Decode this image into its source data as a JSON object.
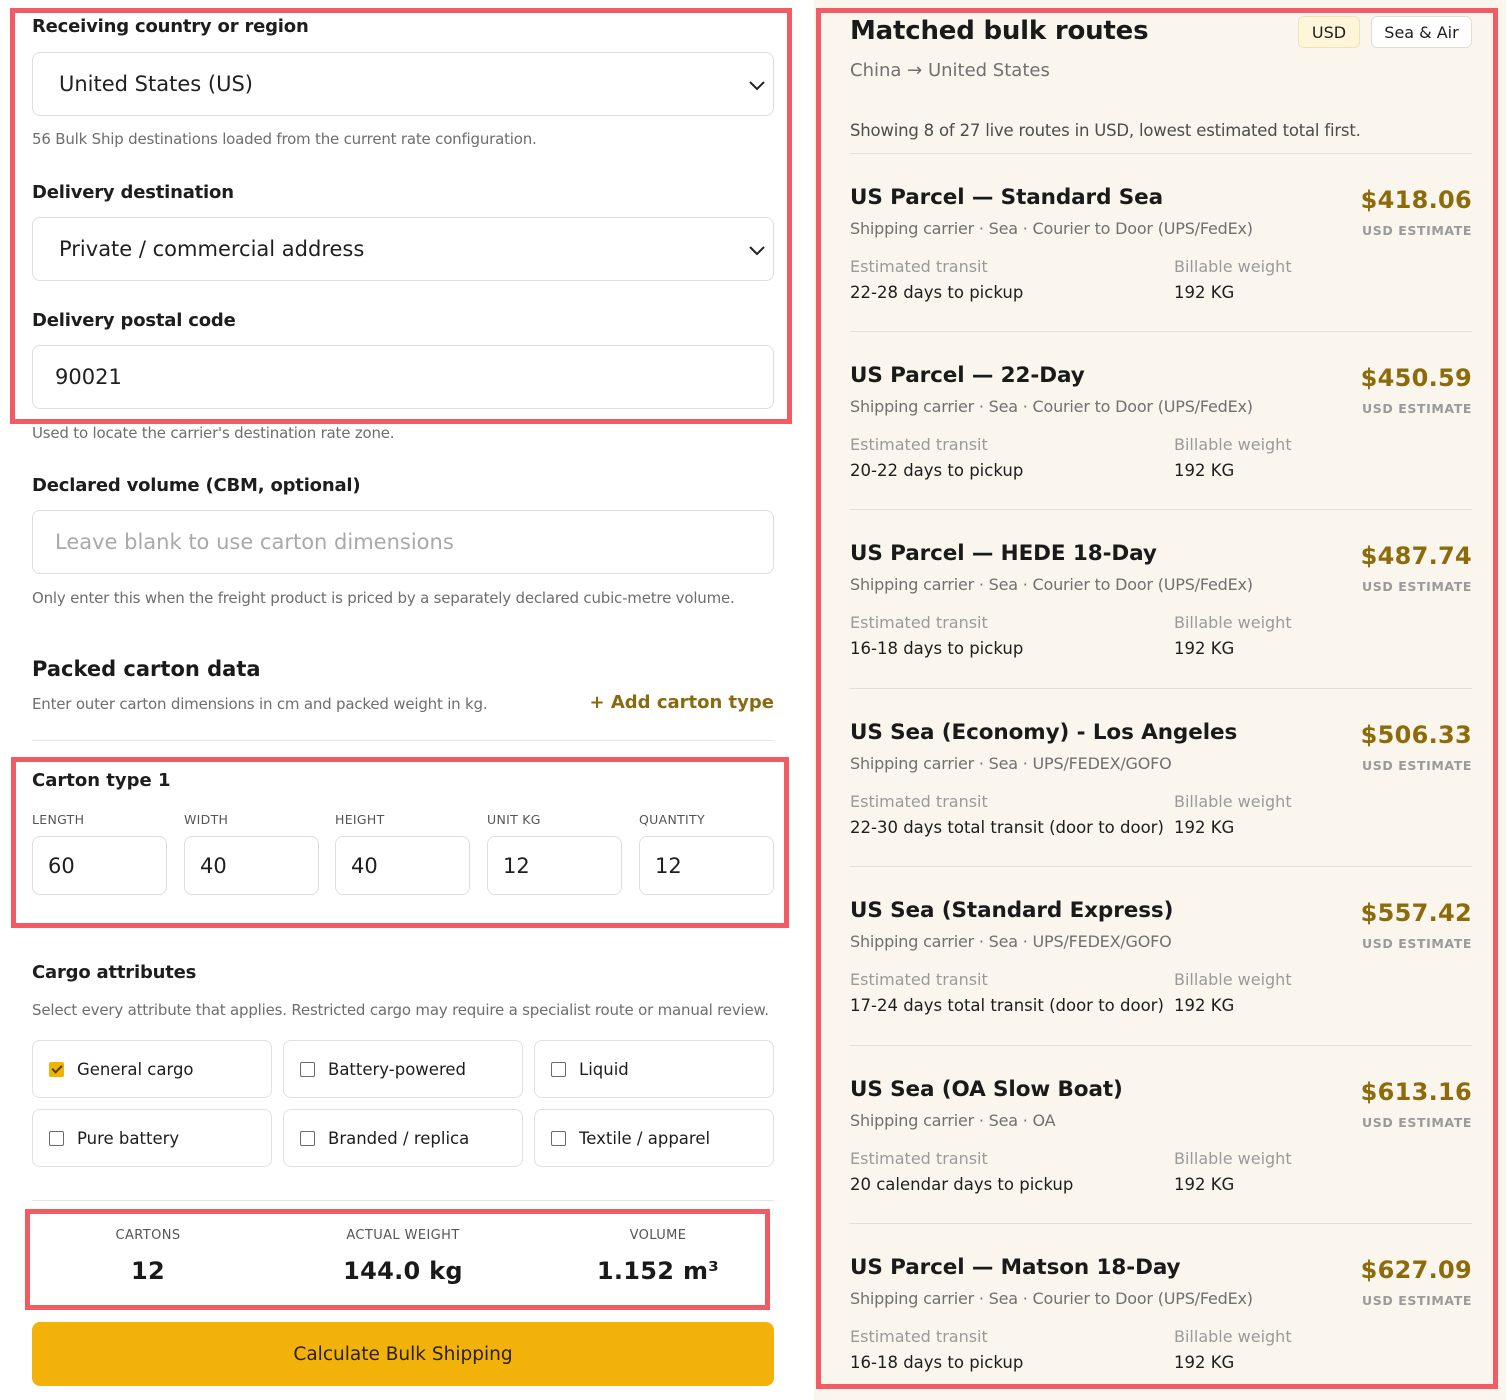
{
  "form": {
    "country_label": "Receiving country or region",
    "country_value": "United States (US)",
    "country_help": "56 Bulk Ship destinations loaded from the current rate configuration.",
    "destination_label": "Delivery destination",
    "destination_value": "Private / commercial address",
    "postal_label": "Delivery postal code",
    "postal_value": "90021",
    "postal_help": "Used to locate the carrier's destination rate zone.",
    "volume_label": "Declared volume (CBM, optional)",
    "volume_placeholder": "Leave blank to use carton dimensions",
    "volume_help": "Only enter this when the freight product is priced by a separately declared cubic-metre volume."
  },
  "carton_section": {
    "title": "Packed carton data",
    "help": "Enter outer carton dimensions in cm and packed weight in kg.",
    "add_label": "+ Add carton type",
    "carton_title": "Carton type 1",
    "fields": [
      {
        "label": "LENGTH",
        "value": "60"
      },
      {
        "label": "WIDTH",
        "value": "40"
      },
      {
        "label": "HEIGHT",
        "value": "40"
      },
      {
        "label": "UNIT KG",
        "value": "12"
      },
      {
        "label": "QUANTITY",
        "value": "12"
      }
    ]
  },
  "cargo": {
    "title": "Cargo attributes",
    "help": "Select every attribute that applies. Restricted cargo may require a specialist route or manual review.",
    "options": [
      {
        "label": "General cargo",
        "checked": true
      },
      {
        "label": "Battery-powered",
        "checked": false
      },
      {
        "label": "Liquid",
        "checked": false
      },
      {
        "label": "Pure battery",
        "checked": false
      },
      {
        "label": "Branded / replica",
        "checked": false
      },
      {
        "label": "Textile / apparel",
        "checked": false
      }
    ]
  },
  "summary": {
    "cartons_label": "CARTONS",
    "cartons_value": "12",
    "weight_label": "ACTUAL WEIGHT",
    "weight_value": "144.0 kg",
    "volume_label": "VOLUME",
    "volume_value": "1.152 m³"
  },
  "calculate_label": "Calculate Bulk Shipping",
  "results": {
    "title": "Matched bulk routes",
    "route_text": "China → United States",
    "currency_pill": "USD",
    "mode_pill": "Sea & Air",
    "info": "Showing 8 of 27 live routes in USD, lowest estimated total first.",
    "transit_label": "Estimated transit",
    "weight_label": "Billable weight",
    "estimate_label": "USD ESTIMATE",
    "routes": [
      {
        "name": "US Parcel — Standard Sea",
        "carrier": "Shipping carrier · Sea · Courier to Door (UPS/FedEx)",
        "price": "$418.06",
        "transit": "22-28 days to pickup",
        "weight": "192 KG"
      },
      {
        "name": "US Parcel — 22-Day",
        "carrier": "Shipping carrier · Sea · Courier to Door (UPS/FedEx)",
        "price": "$450.59",
        "transit": "20-22 days to pickup",
        "weight": "192 KG"
      },
      {
        "name": "US Parcel — HEDE 18-Day",
        "carrier": "Shipping carrier · Sea · Courier to Door (UPS/FedEx)",
        "price": "$487.74",
        "transit": "16-18 days to pickup",
        "weight": "192 KG"
      },
      {
        "name": "US Sea (Economy) - Los Angeles",
        "carrier": "Shipping carrier · Sea · UPS/FEDEX/GOFO",
        "price": "$506.33",
        "transit": "22-30 days total transit (door to door)",
        "weight": "192 KG"
      },
      {
        "name": "US Sea (Standard Express)",
        "carrier": "Shipping carrier · Sea · UPS/FEDEX/GOFO",
        "price": "$557.42",
        "transit": "17-24 days total transit (door to door)",
        "weight": "192 KG"
      },
      {
        "name": "US Sea (OA Slow Boat)",
        "carrier": "Shipping carrier · Sea · OA",
        "price": "$613.16",
        "transit": "20 calendar days to pickup",
        "weight": "192 KG"
      },
      {
        "name": "US Parcel — Matson 18-Day",
        "carrier": "Shipping carrier · Sea · Courier to Door (UPS/FedEx)",
        "price": "$627.09",
        "transit": "16-18 days to pickup",
        "weight": "192 KG"
      }
    ]
  },
  "colors": {
    "accent": "#f2b20a",
    "price": "#8d6a0a",
    "annotation": "#f25b63",
    "panel_bg": "#faf6ee"
  }
}
